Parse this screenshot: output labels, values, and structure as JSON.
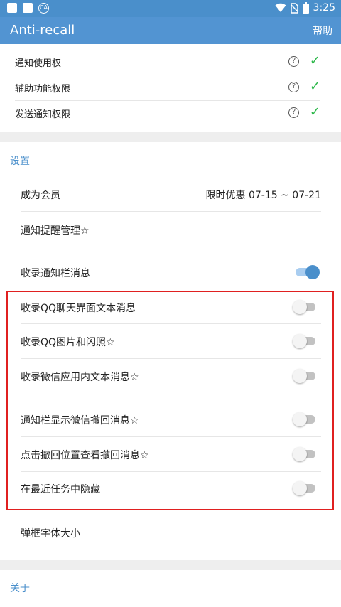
{
  "status_bar": {
    "time": "3:25",
    "left_icon_label": "CA"
  },
  "app_bar": {
    "title": "Anti-recall",
    "help_label": "帮助"
  },
  "permissions": [
    {
      "label": "通知使用权"
    },
    {
      "label": "辅助功能权限"
    },
    {
      "label": "发送通知权限"
    }
  ],
  "settings_header": "设置",
  "settings": {
    "member": {
      "label": "成为会员",
      "value": "限时优惠 07-15 ~ 07-21"
    },
    "notify_manage": {
      "label": "通知提醒管理☆"
    },
    "record_notify": {
      "label": "收录通知栏消息",
      "on": true
    },
    "record_qq_text": {
      "label": "收录QQ聊天界面文本消息",
      "on": false
    },
    "record_qq_image": {
      "label": "收录QQ图片和闪照☆",
      "on": false
    },
    "record_wechat_text": {
      "label": "收录微信应用内文本消息☆",
      "on": false
    },
    "show_wechat_recall": {
      "label": "通知栏显示微信撤回消息☆",
      "on": false
    },
    "click_view_recall": {
      "label": "点击撤回位置查看撤回消息☆",
      "on": false
    },
    "hide_recent": {
      "label": "在最近任务中隐藏",
      "on": false
    },
    "font_size": {
      "label": "弹框字体大小"
    }
  },
  "about_header": "关于",
  "colors": {
    "primary": "#5294d2",
    "accent": "#4a8fcb",
    "check": "#2db84a",
    "highlight_border": "#e02020"
  }
}
